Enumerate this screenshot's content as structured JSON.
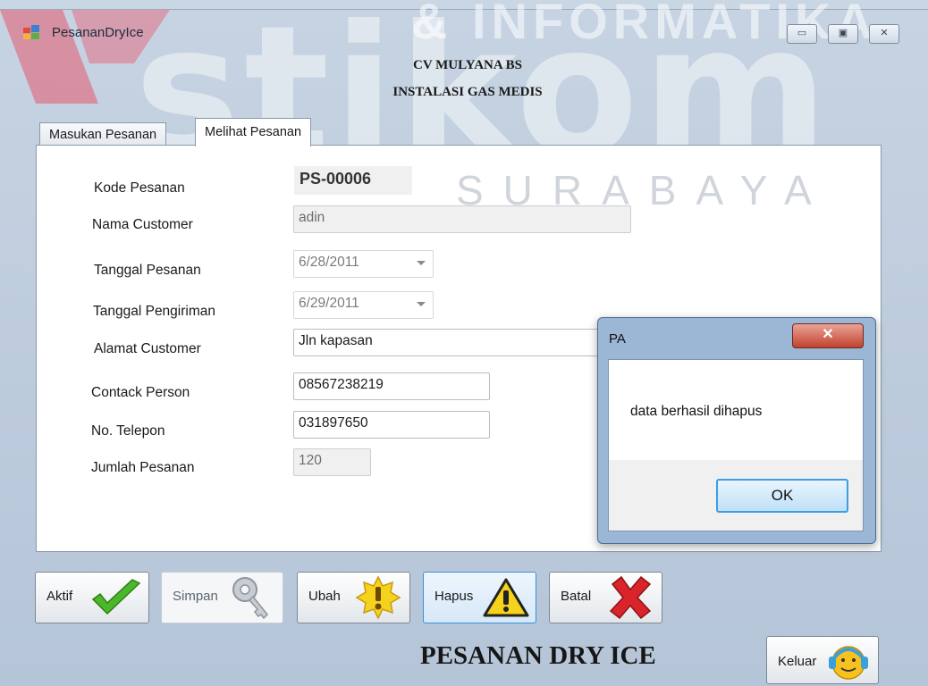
{
  "window": {
    "title": "PesananDryIce",
    "min_glyph": "▭",
    "max_glyph": "▣",
    "close_glyph": "✕"
  },
  "watermark": {
    "main": "stikom",
    "top": "& INFORMATIKA",
    "city": "SURABAYA"
  },
  "header": {
    "company": "CV MULYANA BS",
    "subtitle": "INSTALASI GAS MEDIS"
  },
  "tabs": [
    {
      "label": "Masukan Pesanan",
      "active": false
    },
    {
      "label": "Melihat Pesanan",
      "active": true
    }
  ],
  "form": {
    "kode_label": "Kode Pesanan",
    "kode_value": "PS-00006",
    "nama_label": "Nama Customer",
    "nama_value": "adin",
    "tgl_pesanan_label": "Tanggal Pesanan",
    "tgl_pesanan_value": "6/28/2011",
    "tgl_kirim_label": "Tanggal Pengiriman",
    "tgl_kirim_value": "6/29/2011",
    "alamat_label": "Alamat Customer",
    "alamat_value": "Jln kapasan",
    "contact_label": "Contack Person",
    "contact_value": "08567238219",
    "telepon_label": "No. Telepon",
    "telepon_value": "031897650",
    "jumlah_label": "Jumlah Pesanan",
    "jumlah_value": "120"
  },
  "buttons": {
    "aktif": "Aktif",
    "simpan": "Simpan",
    "ubah": "Ubah",
    "hapus": "Hapus",
    "batal": "Batal",
    "keluar": "Keluar"
  },
  "footer_title": "PESANAN DRY ICE",
  "dialog": {
    "title": "PA",
    "close_glyph": "✕",
    "message": "data berhasil dihapus",
    "ok_label": "OK"
  },
  "colors": {
    "window_bg": "#c6d3e2",
    "check_green": "#4bb82a",
    "warning_yellow": "#f5d21c",
    "close_red": "#c2422f",
    "focus_blue": "#3c9ee0"
  }
}
